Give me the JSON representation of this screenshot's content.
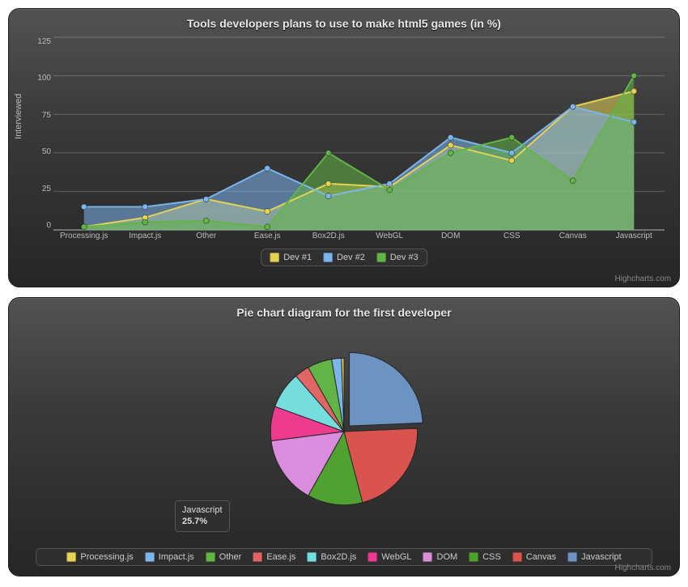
{
  "area": {
    "title": "Tools developers plans to use to make html5 games (in %)",
    "ylabel": "Interviewed",
    "credits": "Highcharts.com",
    "categories": [
      "Processing.js",
      "Impact.js",
      "Other",
      "Ease.js",
      "Box2D.js",
      "WebGL",
      "DOM",
      "CSS",
      "Canvas",
      "Javascript"
    ],
    "yticks": [
      0,
      25,
      50,
      75,
      100,
      125
    ],
    "series": [
      {
        "name": "Dev #1",
        "color": "#e4d354",
        "values": [
          2,
          8,
          20,
          12,
          30,
          28,
          55,
          45,
          80,
          90
        ]
      },
      {
        "name": "Dev #2",
        "color": "#7cb5ec",
        "values": [
          15,
          15,
          20,
          40,
          22,
          30,
          60,
          50,
          80,
          70
        ]
      },
      {
        "name": "Dev #3",
        "color": "#63b446",
        "values": [
          2,
          5,
          6,
          2,
          50,
          26,
          50,
          60,
          32,
          100
        ]
      }
    ]
  },
  "pie": {
    "title": "Pie chart diagram for the first developer",
    "credits": "Highcharts.com",
    "callout": {
      "label": "Javascript",
      "pct": "25.7%"
    },
    "legend": [
      {
        "name": "Processing.js",
        "color": "#e4d354"
      },
      {
        "name": "Impact.js",
        "color": "#7cb5ec"
      },
      {
        "name": "Other",
        "color": "#63b446"
      },
      {
        "name": "Ease.js",
        "color": "#e06666"
      },
      {
        "name": "Box2D.js",
        "color": "#76ddde"
      },
      {
        "name": "WebGL",
        "color": "#ed3b8e"
      },
      {
        "name": "DOM",
        "color": "#d98ddc"
      },
      {
        "name": "CSS",
        "color": "#4fa22f"
      },
      {
        "name": "Canvas",
        "color": "#d9534f"
      },
      {
        "name": "Javascript",
        "color": "#6c94c2"
      }
    ]
  },
  "chart_data": [
    {
      "type": "area",
      "title": "Tools developers plans to use to make html5 games (in %)",
      "ylabel": "Interviewed",
      "ylim": [
        0,
        125
      ],
      "categories": [
        "Processing.js",
        "Impact.js",
        "Other",
        "Ease.js",
        "Box2D.js",
        "WebGL",
        "DOM",
        "CSS",
        "Canvas",
        "Javascript"
      ],
      "series": [
        {
          "name": "Dev #1",
          "values": [
            2,
            8,
            20,
            12,
            30,
            28,
            55,
            45,
            80,
            90
          ]
        },
        {
          "name": "Dev #2",
          "values": [
            15,
            15,
            20,
            40,
            22,
            30,
            60,
            50,
            80,
            70
          ]
        },
        {
          "name": "Dev #3",
          "values": [
            2,
            5,
            6,
            2,
            50,
            26,
            50,
            60,
            32,
            100
          ]
        }
      ],
      "legend_position": "bottom",
      "grid": true
    },
    {
      "type": "pie",
      "title": "Pie chart diagram for the first developer",
      "slices": [
        {
          "name": "Processing.js",
          "value": 2,
          "color": "#e4d354"
        },
        {
          "name": "Impact.js",
          "value": 8,
          "color": "#7cb5ec"
        },
        {
          "name": "Other",
          "value": 20,
          "color": "#63b446"
        },
        {
          "name": "Ease.js",
          "value": 12,
          "color": "#e06666"
        },
        {
          "name": "Box2D.js",
          "value": 30,
          "color": "#76ddde"
        },
        {
          "name": "WebGL",
          "value": 28,
          "color": "#ed3b8e"
        },
        {
          "name": "DOM",
          "value": 55,
          "color": "#d98ddc"
        },
        {
          "name": "CSS",
          "value": 45,
          "color": "#4fa22f"
        },
        {
          "name": "Canvas",
          "value": 80,
          "color": "#d9534f"
        },
        {
          "name": "Javascript",
          "value": 90,
          "color": "#6c94c2"
        }
      ],
      "highlighted": {
        "name": "Javascript",
        "pct": 25.7
      },
      "legend_position": "bottom"
    }
  ]
}
